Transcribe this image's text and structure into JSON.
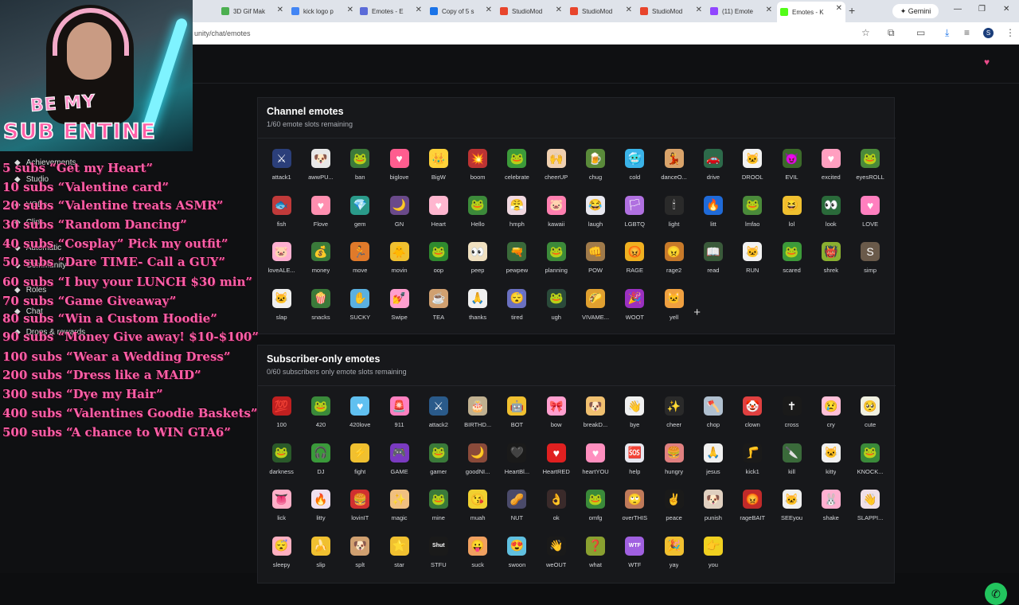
{
  "browser": {
    "tabs": [
      {
        "label": "3D Gif Mak",
        "color": "#4caf50"
      },
      {
        "label": "kick logo p",
        "color": "#4285f4"
      },
      {
        "label": "Emotes - E",
        "color": "#5b6bd8"
      },
      {
        "label": "Copy of 5 s",
        "color": "#1a73e8"
      },
      {
        "label": "StudioMod",
        "color": "#e8452c"
      },
      {
        "label": "StudioMod",
        "color": "#e8452c"
      },
      {
        "label": "StudioMod",
        "color": "#e8452c"
      },
      {
        "label": "(11) Emote",
        "color": "#9146ff"
      },
      {
        "label": "Emotes - K",
        "color": "#53fc18"
      }
    ],
    "new_tab": "+",
    "gemini": "Gemini",
    "url": "unity/chat/emotes",
    "profile_initial": "S"
  },
  "sidebar": {
    "items": [
      "Achievements",
      "Studio",
      "VODs",
      "Clips",
      "Automatic",
      "Community",
      "Roles",
      "Chat",
      "Drops & rewards"
    ]
  },
  "channel_emotes": {
    "title": "Channel emotes",
    "subtitle": "1/60 emote slots remaining",
    "add_label": "+",
    "emotes": [
      {
        "name": "attack1",
        "color": "#2b3f7a",
        "glyph": "⚔"
      },
      {
        "name": "awwPU...",
        "color": "#e8e8e8",
        "glyph": "🐶"
      },
      {
        "name": "ban",
        "color": "#3c7a3a",
        "glyph": "🐸"
      },
      {
        "name": "biglove",
        "color": "#ff5d8f",
        "glyph": "♥"
      },
      {
        "name": "BigW",
        "color": "#ffd23a",
        "glyph": "👑"
      },
      {
        "name": "boom",
        "color": "#b33",
        "glyph": "💥"
      },
      {
        "name": "celebrate",
        "color": "#3c9a3a",
        "glyph": "🐸"
      },
      {
        "name": "cheerUP",
        "color": "#f0d0b0",
        "glyph": "🙌"
      },
      {
        "name": "chug",
        "color": "#5a8a3a",
        "glyph": "🍺"
      },
      {
        "name": "cold",
        "color": "#3ab3e8",
        "glyph": "🥶"
      },
      {
        "name": "danceO...",
        "color": "#d9a36a",
        "glyph": "💃"
      },
      {
        "name": "drive",
        "color": "#2d6a4a",
        "glyph": "🚗"
      },
      {
        "name": "DROOL",
        "color": "#f2f2f2",
        "glyph": "🐱"
      },
      {
        "name": "EVIL",
        "color": "#3c6a2a",
        "glyph": "😈"
      },
      {
        "name": "excited",
        "color": "#ff9fc0",
        "glyph": "♥"
      },
      {
        "name": "eyesROLL",
        "color": "#4a8a3a",
        "glyph": "🐸"
      },
      {
        "name": "fish",
        "color": "#c03a3a",
        "glyph": "🐟"
      },
      {
        "name": "Flove",
        "color": "#ff8fb0",
        "glyph": "♥"
      },
      {
        "name": "gem",
        "color": "#2a9a8a",
        "glyph": "💎"
      },
      {
        "name": "GN",
        "color": "#6a4a8a",
        "glyph": "🌙"
      },
      {
        "name": "Heart",
        "color": "#ffb6cf",
        "glyph": "♥"
      },
      {
        "name": "Hello",
        "color": "#3c8a3a",
        "glyph": "🐸"
      },
      {
        "name": "hmph",
        "color": "#f0d8e0",
        "glyph": "😤"
      },
      {
        "name": "kawaii",
        "color": "#ff7fb0",
        "glyph": "🐷"
      },
      {
        "name": "laugh",
        "color": "#e8e8f0",
        "glyph": "😂"
      },
      {
        "name": "LGBTQ",
        "color": "#b070e0",
        "glyph": "🏳"
      },
      {
        "name": "light",
        "color": "#2a2a2a",
        "glyph": "🕯"
      },
      {
        "name": "litt",
        "color": "#1f6ad8",
        "glyph": "🔥"
      },
      {
        "name": "lmfao",
        "color": "#4a8a3a",
        "glyph": "🐸"
      },
      {
        "name": "lol",
        "color": "#f0c030",
        "glyph": "😆"
      },
      {
        "name": "look",
        "color": "#2a6a3a",
        "glyph": "👀"
      },
      {
        "name": "LOVE",
        "color": "#ff7fbf",
        "glyph": "♥"
      },
      {
        "name": "loveALE...",
        "color": "#ffb0d0",
        "glyph": "🐷"
      },
      {
        "name": "money",
        "color": "#3a7a3a",
        "glyph": "💰"
      },
      {
        "name": "move",
        "color": "#e07a2a",
        "glyph": "🏃"
      },
      {
        "name": "movin",
        "color": "#f0c030",
        "glyph": "🐥"
      },
      {
        "name": "oop",
        "color": "#2f8a2f",
        "glyph": "🐸"
      },
      {
        "name": "peep",
        "color": "#f0e0c0",
        "glyph": "👀"
      },
      {
        "name": "pewpew",
        "color": "#3a6a3a",
        "glyph": "🔫"
      },
      {
        "name": "planning",
        "color": "#3c8a3a",
        "glyph": "🐸"
      },
      {
        "name": "POW",
        "color": "#a07a4a",
        "glyph": "👊"
      },
      {
        "name": "RAGE",
        "color": "#f0b020",
        "glyph": "😡"
      },
      {
        "name": "rage2",
        "color": "#c87a2a",
        "glyph": "😠"
      },
      {
        "name": "read",
        "color": "#3a5a3a",
        "glyph": "📖"
      },
      {
        "name": "RUN",
        "color": "#f2f2f2",
        "glyph": "🐱"
      },
      {
        "name": "scared",
        "color": "#3c9a3a",
        "glyph": "🐸"
      },
      {
        "name": "shrek",
        "color": "#8ab030",
        "glyph": "👹"
      },
      {
        "name": "simp",
        "color": "#6a5a4a",
        "glyph": "S"
      },
      {
        "name": "slap",
        "color": "#f0f0f0",
        "glyph": "🐱"
      },
      {
        "name": "snacks",
        "color": "#3a7a3a",
        "glyph": "🍿"
      },
      {
        "name": "SUCKY",
        "color": "#5ab0e0",
        "glyph": "✋"
      },
      {
        "name": "Swipe",
        "color": "#ff9fcf",
        "glyph": "💅"
      },
      {
        "name": "TEA",
        "color": "#d0a070",
        "glyph": "☕"
      },
      {
        "name": "thanks",
        "color": "#f0f0f0",
        "glyph": "🙏"
      },
      {
        "name": "tired",
        "color": "#6a70c0",
        "glyph": "😴"
      },
      {
        "name": "ugh",
        "color": "#2a4a3a",
        "glyph": "🐸"
      },
      {
        "name": "VIVAME...",
        "color": "#e0a030",
        "glyph": "🌮"
      },
      {
        "name": "WOOT",
        "color": "#9a30c0",
        "glyph": "🎉"
      },
      {
        "name": "yell",
        "color": "#f0a040",
        "glyph": "🐱"
      }
    ]
  },
  "subscriber_emotes": {
    "title": "Subscriber-only emotes",
    "subtitle": "0/60 subscribers only emote slots remaining",
    "emotes": [
      {
        "name": "100",
        "color": "#c02020",
        "glyph": "💯"
      },
      {
        "name": "420",
        "color": "#3a8a3a",
        "glyph": "🐸"
      },
      {
        "name": "420love",
        "color": "#60c0f0",
        "glyph": "♥"
      },
      {
        "name": "911",
        "color": "#ff80c0",
        "glyph": "🚨"
      },
      {
        "name": "attack2",
        "color": "#2a5a8a",
        "glyph": "⚔"
      },
      {
        "name": "BIRTHD...",
        "color": "#c0b090",
        "glyph": "🎂"
      },
      {
        "name": "BOT",
        "color": "#f0c030",
        "glyph": "🤖"
      },
      {
        "name": "bow",
        "color": "#ff9fcf",
        "glyph": "🎀"
      },
      {
        "name": "breakD...",
        "color": "#f0c070",
        "glyph": "🐶"
      },
      {
        "name": "bye",
        "color": "#f0f0f0",
        "glyph": "👋"
      },
      {
        "name": "cheer",
        "color": "#2a2a2a",
        "glyph": "✨"
      },
      {
        "name": "chop",
        "color": "#b0c0d0",
        "glyph": "🪓"
      },
      {
        "name": "clown",
        "color": "#e04040",
        "glyph": "🤡"
      },
      {
        "name": "cross",
        "color": "#1a1a1a",
        "glyph": "✝"
      },
      {
        "name": "cry",
        "color": "#ffc0d8",
        "glyph": "😢"
      },
      {
        "name": "cute",
        "color": "#f0f0e0",
        "glyph": "🥺"
      },
      {
        "name": "darkness",
        "color": "#2a5a2a",
        "glyph": "🐸"
      },
      {
        "name": "DJ",
        "color": "#3a9a3a",
        "glyph": "🎧"
      },
      {
        "name": "fight",
        "color": "#f0c030",
        "glyph": "⚡"
      },
      {
        "name": "GAME",
        "color": "#7a3ac0",
        "glyph": "🎮"
      },
      {
        "name": "gamer",
        "color": "#3a7a3a",
        "glyph": "🐸"
      },
      {
        "name": "goodNI...",
        "color": "#8a4a3a",
        "glyph": "🌙"
      },
      {
        "name": "HeartBl...",
        "color": "#1a1a1a",
        "glyph": "🖤"
      },
      {
        "name": "HeartRED",
        "color": "#e02020",
        "glyph": "♥"
      },
      {
        "name": "heartYOU",
        "color": "#ff8fbf",
        "glyph": "♥"
      },
      {
        "name": "help",
        "color": "#e8e8f0",
        "glyph": "🆘"
      },
      {
        "name": "hungry",
        "color": "#e08080",
        "glyph": "🍔"
      },
      {
        "name": "jesus",
        "color": "#f0f0f0",
        "glyph": "🙏"
      },
      {
        "name": "kick1",
        "color": "#1a1a1a",
        "glyph": "🦵"
      },
      {
        "name": "kill",
        "color": "#3a6a3a",
        "glyph": "🔪"
      },
      {
        "name": "kitty",
        "color": "#f0f0f0",
        "glyph": "🐱"
      },
      {
        "name": "KNOCK...",
        "color": "#3a8a3a",
        "glyph": "🐸"
      },
      {
        "name": "lick",
        "color": "#ffb0c8",
        "glyph": "👅"
      },
      {
        "name": "litty",
        "color": "#f0e0f0",
        "glyph": "🔥"
      },
      {
        "name": "lovinIT",
        "color": "#d03030",
        "glyph": "🍔"
      },
      {
        "name": "magic",
        "color": "#f0c080",
        "glyph": "✨"
      },
      {
        "name": "mine",
        "color": "#3a7a3a",
        "glyph": "🐸"
      },
      {
        "name": "muah",
        "color": "#f0d030",
        "glyph": "😘"
      },
      {
        "name": "NUT",
        "color": "#4a4a6a",
        "glyph": "🥜"
      },
      {
        "name": "ok",
        "color": "#3a2a2a",
        "glyph": "👌"
      },
      {
        "name": "omfg",
        "color": "#3a8a3a",
        "glyph": "🐸"
      },
      {
        "name": "overTHIS",
        "color": "#c07a5a",
        "glyph": "🙄"
      },
      {
        "name": "peace",
        "color": "#1a1a1a",
        "glyph": "✌"
      },
      {
        "name": "punish",
        "color": "#e0d0c0",
        "glyph": "🐶"
      },
      {
        "name": "rageBAIT",
        "color": "#c02a2a",
        "glyph": "😡"
      },
      {
        "name": "SEEyou",
        "color": "#f0f0f0",
        "glyph": "🐱"
      },
      {
        "name": "shake",
        "color": "#ffb0d0",
        "glyph": "🐰"
      },
      {
        "name": "SLAPPI...",
        "color": "#f0e0e8",
        "glyph": "👋"
      },
      {
        "name": "sleepy",
        "color": "#ffb0c0",
        "glyph": "😴"
      },
      {
        "name": "slip",
        "color": "#f0c030",
        "glyph": "🍌"
      },
      {
        "name": "splt",
        "color": "#d0a070",
        "glyph": "🐶"
      },
      {
        "name": "star",
        "color": "#f0c030",
        "glyph": "⭐"
      },
      {
        "name": "STFU",
        "color": "#1a1a1a",
        "glyph": "Shut"
      },
      {
        "name": "suck",
        "color": "#f0a060",
        "glyph": "😛"
      },
      {
        "name": "swoon",
        "color": "#60c0e0",
        "glyph": "😍"
      },
      {
        "name": "weOUT",
        "color": "#1a1a1a",
        "glyph": "👋"
      },
      {
        "name": "what",
        "color": "#8aa030",
        "glyph": "❓"
      },
      {
        "name": "WTF",
        "color": "#a060e0",
        "glyph": "WTF"
      },
      {
        "name": "yay",
        "color": "#f0c030",
        "glyph": "🎉"
      },
      {
        "name": "you",
        "color": "#f0d020",
        "glyph": "👉"
      }
    ]
  },
  "overlay": {
    "banner_line1": "BE MY",
    "banner_line2": "SUB ENTINE",
    "goals": [
      "5 subs “Get my Heart”",
      "10 subs “Valentine card”",
      "20 subs “Valentine treats ASMR”",
      "30 subs “Random Dancing”",
      "40 subs “Cosplay” Pick my outfit”",
      "50 subs “Dare TIME- Call a GUY”",
      "60 subs “I buy your LUNCH $30 min”",
      "70 subs “Game Giveaway”",
      "80 subs “Win a Custom Hoodie”",
      "90 subs “Money Give away! $10-$100”",
      "100 subs “Wear a Wedding Dress”",
      "200 subs “Dress like a MAID”",
      "300 subs “Dye my Hair”",
      "400 subs “Valentines Goodie Baskets”",
      "500 subs “A chance to WIN GTA6”"
    ]
  },
  "colors": {
    "accent": "#53fc18",
    "goal_pink": "#ff5fa7",
    "help_fab": "#22c55e"
  }
}
